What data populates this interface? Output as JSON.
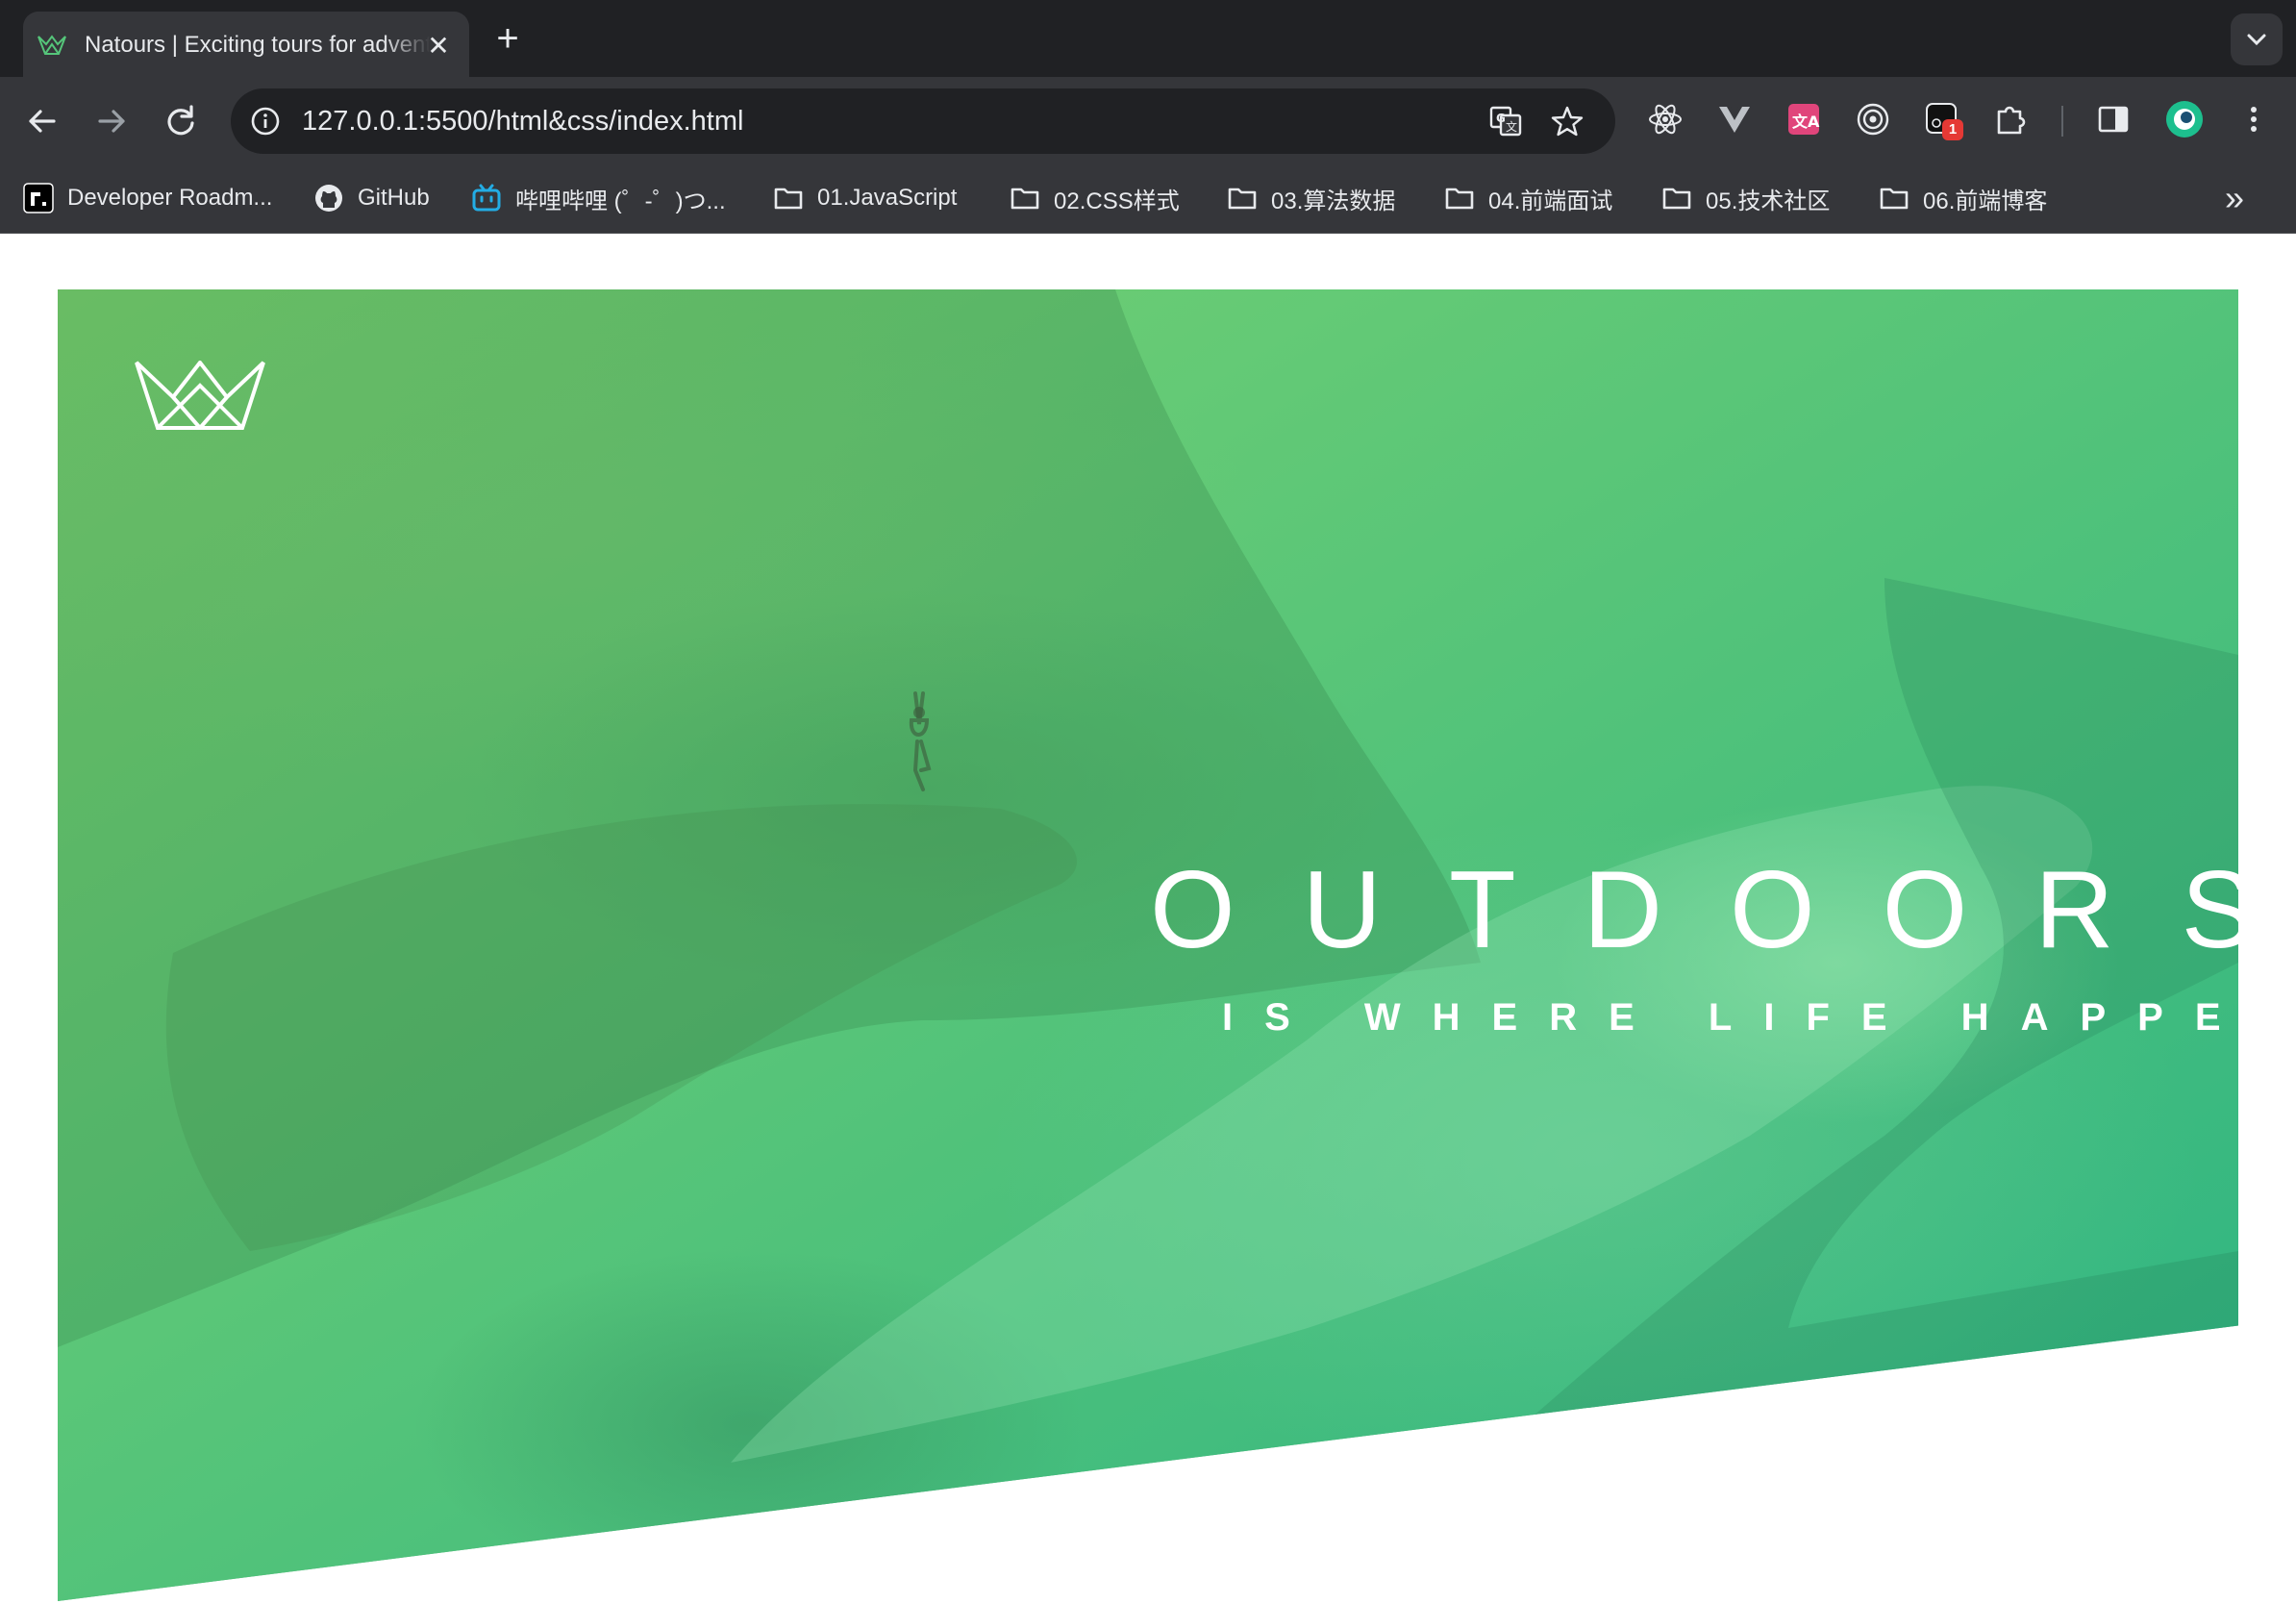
{
  "browser": {
    "tab": {
      "title": "Natours | Exciting tours for adventurous people",
      "close_glyph": "✕"
    },
    "new_tab_glyph": "+",
    "url": "127.0.0.1:5500/html&css/index.html",
    "toolbar_icons": [
      "back-icon",
      "forward-icon",
      "reload-icon",
      "translate-icon",
      "bookmark-star-icon",
      "react-devtools-icon",
      "vue-devtools-icon",
      "translator-extension-icon",
      "target-extension-icon",
      "screen-record-extension-icon",
      "extensions-puzzle-icon",
      "side-panel-icon",
      "profile-avatar"
    ],
    "extension_badge": "1",
    "bookmarks": [
      {
        "label": "Developer Roadm...",
        "icon": "roadmap-icon"
      },
      {
        "label": "GitHub",
        "icon": "github-icon"
      },
      {
        "label": "哔哩哔哩 (゜-゜)つ...",
        "icon": "bilibili-icon"
      },
      {
        "label": "01.JavaScript",
        "icon": "folder-icon"
      },
      {
        "label": "02.CSS样式",
        "icon": "folder-icon"
      },
      {
        "label": "03.算法数据",
        "icon": "folder-icon"
      },
      {
        "label": "04.前端面试",
        "icon": "folder-icon"
      },
      {
        "label": "05.技术社区",
        "icon": "folder-icon"
      },
      {
        "label": "06.前端博客",
        "icon": "folder-icon"
      }
    ],
    "bookmarks_overflow_glyph": "»"
  },
  "page": {
    "heading_main": "OUTDOORS",
    "heading_sub": "IS WHERE LIFE HAPPENS",
    "gradient_colors": [
      "#7ed56f",
      "#28b485"
    ]
  }
}
